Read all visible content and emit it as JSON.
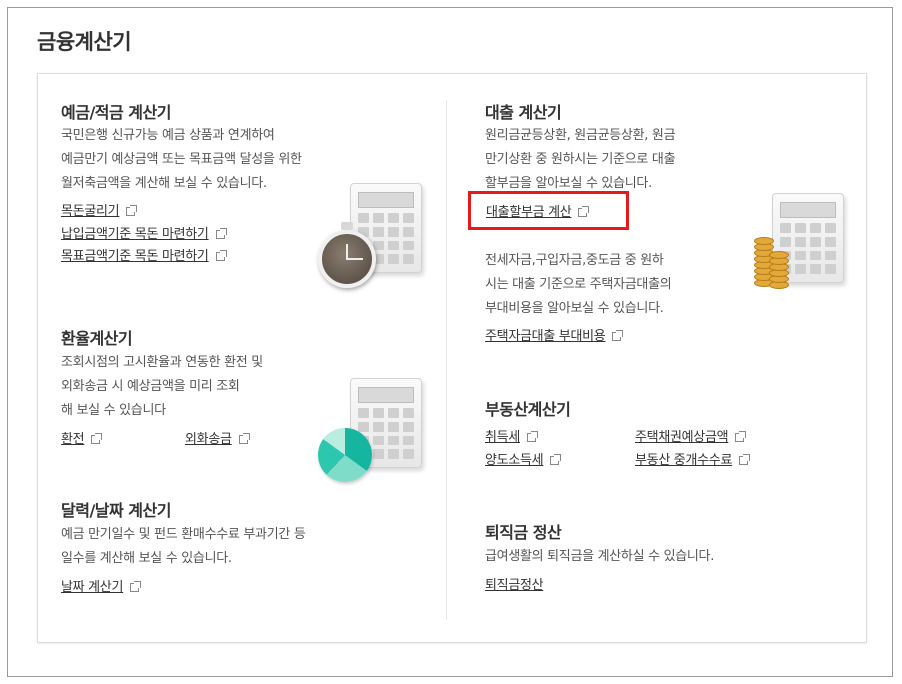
{
  "page": {
    "title": "금융계산기"
  },
  "deposit": {
    "title": "예금/적금 계산기",
    "desc": [
      "국민은행 신규가능 예금 상품과 연계하여",
      "예금만기 예상금액 또는 목표금액 달성을 위한",
      "월저축금액을 계산해 보실 수 있습니다."
    ],
    "links": [
      "목돈굴리기",
      "납입금액기준 목돈 마련하기",
      "목표금액기준 목돈 마련하기"
    ]
  },
  "exchange": {
    "title": "환율계산기",
    "desc": [
      "조회시점의 고시환율과 연동한 환전 및",
      "외화송금 시 예상금액을 미리 조회",
      "해 보실 수 있습니다"
    ],
    "links": [
      "환전",
      "외화송금"
    ]
  },
  "date": {
    "title": "달력/날짜 계산기",
    "desc": [
      "예금 만기일수 및 펀드 환매수수료 부과기간 등",
      "일수를 계산해 보실 수 있습니다."
    ],
    "links": [
      "날짜 계산기"
    ]
  },
  "loan": {
    "title": "대출 계산기",
    "desc1": [
      "원리금균등상환, 원금균등상환, 원금",
      "만기상환 중 원하시는 기준으로 대출",
      "할부금을 알아보실 수 있습니다."
    ],
    "link1": "대출할부금 계산",
    "desc2": [
      "전세자금,구입자금,중도금 중 원하",
      "시는 대출 기준으로 주택자금대출의",
      "부대비용을 알아보실 수 있습니다."
    ],
    "link2": "주택자금대출 부대비용"
  },
  "realestate": {
    "title": "부동산계산기",
    "links": [
      "취득세",
      "주택채권예상금액",
      "양도소득세",
      "부동산 중개수수료"
    ]
  },
  "severance": {
    "title": "퇴직금 정산",
    "desc": [
      "급여생활의 퇴직금을 계산하실 수 있습니다."
    ],
    "link": "퇴직금정산"
  },
  "colors": {
    "highlight": "#e8191b",
    "pie": "#16b5a0",
    "coin": "#e2a93a"
  },
  "icons": [
    "external-link-icon",
    "calculator-icon",
    "clock-icon",
    "pie-chart-icon",
    "coins-icon"
  ]
}
